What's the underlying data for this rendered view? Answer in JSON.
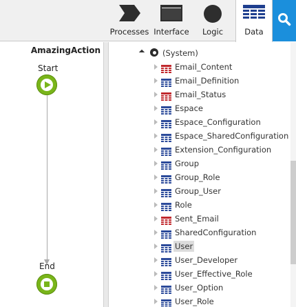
{
  "toolbar": {
    "tabs": [
      {
        "label": "Processes",
        "icon": "processes-chevron-icon"
      },
      {
        "label": "Interface",
        "icon": "interface-window-icon"
      },
      {
        "label": "Logic",
        "icon": "logic-circle-icon"
      },
      {
        "label": "Data",
        "icon": "data-grid-icon",
        "active": true
      }
    ],
    "search_icon": "search-icon",
    "accent_color": "#1b8fdc"
  },
  "canvas": {
    "action_title": "AmazingAction",
    "start_label": "Start",
    "end_label": "End",
    "node_color": "#79b51a"
  },
  "tree": {
    "root": {
      "label": "(System)",
      "icon": "system-module-icon"
    },
    "items": [
      {
        "label": "Email_Content",
        "icon": "entity-static-icon",
        "color": "#c0282d"
      },
      {
        "label": "Email_Definition",
        "icon": "entity-icon",
        "color": "#2b4a9a"
      },
      {
        "label": "Email_Status",
        "icon": "entity-static-icon",
        "color": "#c0282d"
      },
      {
        "label": "Espace",
        "icon": "entity-icon",
        "color": "#2b4a9a"
      },
      {
        "label": "Espace_Configuration",
        "icon": "entity-icon",
        "color": "#2b4a9a"
      },
      {
        "label": "Espace_SharedConfiguration",
        "icon": "entity-icon",
        "color": "#2b4a9a"
      },
      {
        "label": "Extension_Configuration",
        "icon": "entity-icon",
        "color": "#2b4a9a"
      },
      {
        "label": "Group",
        "icon": "entity-icon",
        "color": "#2b4a9a"
      },
      {
        "label": "Group_Role",
        "icon": "entity-icon",
        "color": "#2b4a9a"
      },
      {
        "label": "Group_User",
        "icon": "entity-icon",
        "color": "#2b4a9a"
      },
      {
        "label": "Role",
        "icon": "entity-icon",
        "color": "#2b4a9a"
      },
      {
        "label": "Sent_Email",
        "icon": "entity-static-icon",
        "color": "#c0282d"
      },
      {
        "label": "SharedConfiguration",
        "icon": "entity-icon",
        "color": "#2b4a9a"
      },
      {
        "label": "User",
        "icon": "entity-icon",
        "color": "#2b4a9a",
        "selected": true
      },
      {
        "label": "User_Developer",
        "icon": "entity-icon",
        "color": "#2b4a9a"
      },
      {
        "label": "User_Effective_Role",
        "icon": "entity-icon",
        "color": "#2b4a9a"
      },
      {
        "label": "User_Option",
        "icon": "entity-icon",
        "color": "#2b4a9a"
      },
      {
        "label": "User_Role",
        "icon": "entity-icon",
        "color": "#2b4a9a"
      }
    ]
  }
}
